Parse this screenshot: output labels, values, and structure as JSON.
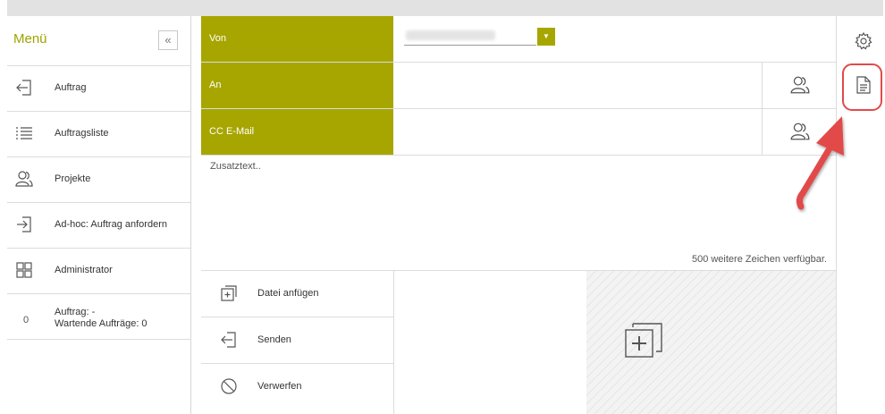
{
  "sidebar": {
    "title": "Menü",
    "collapse_glyph": "«",
    "items": [
      {
        "label": "Auftrag",
        "icon": "arrow-left-into-bracket-icon"
      },
      {
        "label": "Auftragsliste",
        "icon": "list-icon"
      },
      {
        "label": "Projekte",
        "icon": "users-icon"
      },
      {
        "label": "Ad-hoc: Auftrag anfordern",
        "icon": "arrow-right-into-bracket-icon"
      },
      {
        "label": "Administrator",
        "icon": "grid-icon"
      }
    ],
    "status": {
      "count": "0",
      "line1": "Auftrag: -",
      "line2": "Wartende Aufträge: 0"
    }
  },
  "form": {
    "von_label": "Von",
    "an_label": "An",
    "cc_label": "CC E-Mail",
    "text_placeholder": "Zusatztext..",
    "counter": "500 weitere Zeichen verfügbar.",
    "actions": [
      {
        "label": "Datei anfügen",
        "icon": "attach-file-icon"
      },
      {
        "label": "Senden",
        "icon": "send-icon"
      },
      {
        "label": "Verwerfen",
        "icon": "discard-icon"
      }
    ]
  },
  "colors": {
    "accent": "#a7a600",
    "highlight": "#e24a4a"
  }
}
